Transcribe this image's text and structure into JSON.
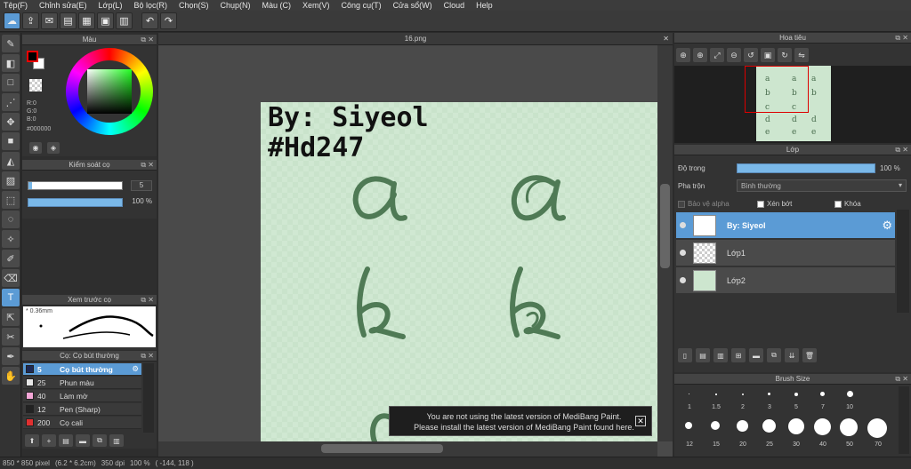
{
  "menu": [
    "Tệp(F)",
    "Chỉnh sửa(E)",
    "Lớp(L)",
    "Bộ lọc(R)",
    "Chọn(S)",
    "Chụp(N)",
    "Màu (C)",
    "Xem(V)",
    "Công cụ(T)",
    "Cửa sổ(W)",
    "Cloud",
    "Help"
  ],
  "color_panel": {
    "title": "Màu",
    "r": "R:0",
    "g": "G:0",
    "b": "B:0",
    "hex": "#000000"
  },
  "brush_control": {
    "title": "Kiểm soát cọ",
    "size": "5",
    "opacity": "100 %"
  },
  "brush_preview": {
    "title": "Xem trước cọ",
    "size": "* 0.36mm"
  },
  "brush_list": {
    "title": "Cọ: Cọ bút thường",
    "items": [
      {
        "num": "5",
        "name": "Cọ bút thường",
        "color": "#1e2a55"
      },
      {
        "num": "25",
        "name": "Phun màu",
        "color": "#e6e6e6"
      },
      {
        "num": "40",
        "name": "Làm mờ",
        "color": "#f3a6d6"
      },
      {
        "num": "12",
        "name": "Pen (Sharp)",
        "color": "#222222"
      },
      {
        "num": "200",
        "name": "Cọ cali",
        "color": "#e03030"
      }
    ]
  },
  "document": {
    "tab": "16.png",
    "line1": "By: Siyeol",
    "line2": "#Hd247"
  },
  "toast": {
    "line1": "You are not using the latest version of MediBang Paint.",
    "line2": "Please install the latest version of MediBang Paint found here."
  },
  "status": {
    "dims": "850 * 850 pixel",
    "cm": "(6.2 * 6.2cm)",
    "dpi": "350 dpi",
    "zoom": "100 %",
    "coords": "( -144, 118 )"
  },
  "navigator": {
    "title": "Hoa tiêu"
  },
  "layers": {
    "title": "Lớp",
    "opacity_label": "Độ trong",
    "opacity_value": "100 %",
    "blend_label": "Pha trộn",
    "blend_value": "Bình thường",
    "alpha_label": "Bảo vệ alpha",
    "clip_label": "Xén bớt",
    "lock_label": "Khóa",
    "items": [
      "By: Siyeol",
      "Lớp1",
      "Lớp2"
    ]
  },
  "brush_size": {
    "title": "Brush Size",
    "row1": [
      "1",
      "1.5",
      "2",
      "3",
      "5",
      "7",
      "10"
    ],
    "row2": [
      "12",
      "15",
      "20",
      "25",
      "30",
      "40",
      "50",
      "70"
    ]
  }
}
